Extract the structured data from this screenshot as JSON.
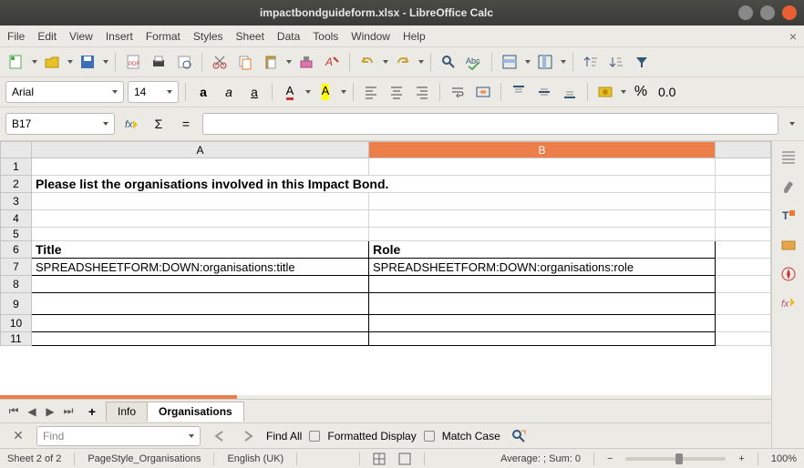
{
  "window": {
    "title": "impactbondguideform.xlsx - LibreOffice Calc"
  },
  "menu": {
    "file": "File",
    "edit": "Edit",
    "view": "View",
    "insert": "Insert",
    "format": "Format",
    "styles": "Styles",
    "sheet": "Sheet",
    "data": "Data",
    "tools": "Tools",
    "window": "Window",
    "help": "Help"
  },
  "font": {
    "name": "Arial",
    "size": "14"
  },
  "formula_bar": {
    "cell_ref": "B17",
    "sigma": "Σ",
    "equals": "=",
    "value": ""
  },
  "columns": {
    "A": "A",
    "B": "B"
  },
  "rows": {
    "r2": {
      "A": "Please list the organisations involved in this Impact Bond."
    },
    "r6": {
      "A": "Title",
      "B": "Role"
    },
    "r7": {
      "A": "SPREADSHEETFORM:DOWN:organisations:title",
      "B": "SPREADSHEETFORM:DOWN:organisations:role"
    }
  },
  "tabs": {
    "t1": "Info",
    "t2": "Organisations"
  },
  "find": {
    "placeholder": "Find",
    "find_all": "Find All",
    "formatted": "Formatted Display",
    "match_case": "Match Case"
  },
  "status": {
    "sheet": "Sheet 2 of 2",
    "pagestyle": "PageStyle_Organisations",
    "lang": "English (UK)",
    "aggregate": "Average: ; Sum: 0",
    "zoom": "100%"
  },
  "toolbar2": {
    "percent": "%",
    "zerozero": "0.0"
  },
  "chart_data": null
}
